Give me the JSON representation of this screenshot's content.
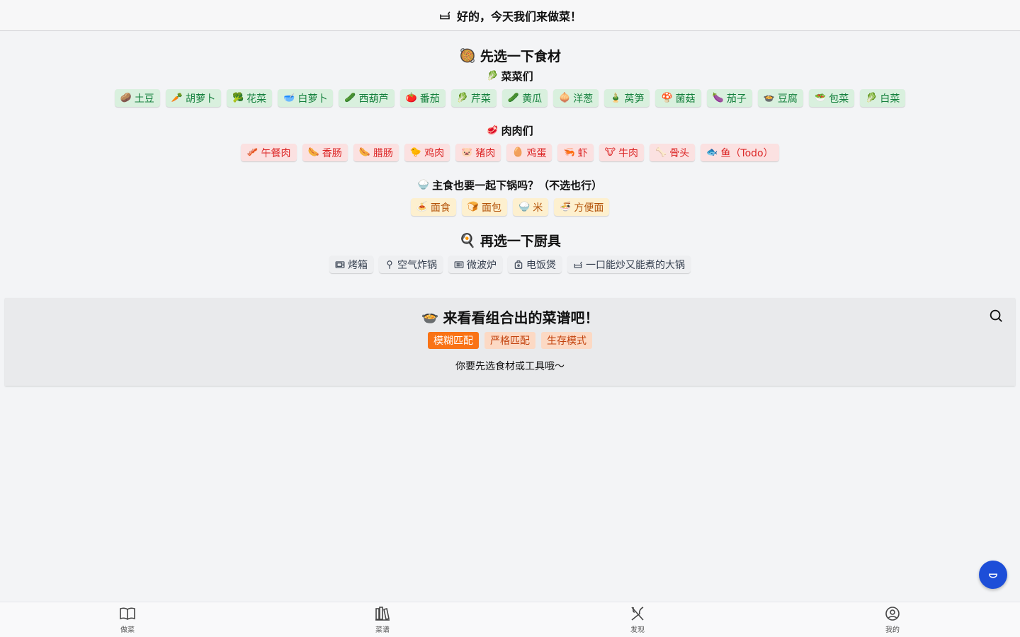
{
  "header": {
    "title": "好的，今天我们来做菜！",
    "icon": "pot-icon"
  },
  "ingredients": {
    "title": "先选一下食材",
    "icon": "🥘",
    "veg": {
      "title": "菜菜们",
      "icon": "🥬",
      "items": [
        {
          "icon": "🥔",
          "label": "土豆"
        },
        {
          "icon": "🥕",
          "label": "胡萝卜"
        },
        {
          "icon": "🥦",
          "label": "花菜"
        },
        {
          "icon": "🥣",
          "label": "白萝卜"
        },
        {
          "icon": "🥒",
          "label": "西葫芦"
        },
        {
          "icon": "🍅",
          "label": "番茄"
        },
        {
          "icon": "🥬",
          "label": "芹菜"
        },
        {
          "icon": "🥒",
          "label": "黄瓜"
        },
        {
          "icon": "🧅",
          "label": "洋葱"
        },
        {
          "icon": "🎍",
          "label": "莴笋"
        },
        {
          "icon": "🍄",
          "label": "菌菇"
        },
        {
          "icon": "🍆",
          "label": "茄子"
        },
        {
          "icon": "🍲",
          "label": "豆腐"
        },
        {
          "icon": "🥗",
          "label": "包菜"
        },
        {
          "icon": "🥬",
          "label": "白菜"
        }
      ]
    },
    "meat": {
      "title": "肉肉们",
      "icon": "🥩",
      "items": [
        {
          "icon": "🥓",
          "label": "午餐肉"
        },
        {
          "icon": "🌭",
          "label": "香肠"
        },
        {
          "icon": "🌭",
          "label": "腊肠"
        },
        {
          "icon": "🐤",
          "label": "鸡肉"
        },
        {
          "icon": "🐷",
          "label": "猪肉"
        },
        {
          "icon": "🥚",
          "label": "鸡蛋"
        },
        {
          "icon": "🦐",
          "label": "虾"
        },
        {
          "icon": "🐮",
          "label": "牛肉"
        },
        {
          "icon": "🦴",
          "label": "骨头"
        },
        {
          "icon": "🐟",
          "label": "鱼（Todo）"
        }
      ]
    },
    "staple": {
      "title": "主食也要一起下锅吗？（不选也行）",
      "icon": "🍚",
      "items": [
        {
          "icon": "🍝",
          "label": "面食"
        },
        {
          "icon": "🍞",
          "label": "面包"
        },
        {
          "icon": "🍚",
          "label": "米"
        },
        {
          "icon": "🍜",
          "label": "方便面"
        }
      ]
    }
  },
  "tools": {
    "title": "再选一下厨具",
    "icon": "🍳",
    "items": [
      {
        "icon": "oven-icon",
        "label": "烤箱"
      },
      {
        "icon": "air-fryer-icon",
        "label": "空气炸锅"
      },
      {
        "icon": "microwave-icon",
        "label": "微波炉"
      },
      {
        "icon": "rice-cooker-icon",
        "label": "电饭煲"
      },
      {
        "icon": "wok-icon",
        "label": "一口能炒又能煮的大锅"
      }
    ]
  },
  "results": {
    "title": "来看看组合出的菜谱吧！",
    "icon": "🍲",
    "modes": [
      "模糊匹配",
      "严格匹配",
      "生存模式"
    ],
    "active_mode": "模糊匹配",
    "hint": "你要先选食材或工具哦～"
  },
  "nav": [
    {
      "label": "做菜",
      "icon": "book-icon"
    },
    {
      "label": "菜谱",
      "icon": "library-icon"
    },
    {
      "label": "发现",
      "icon": "utensils-icon"
    },
    {
      "label": "我的",
      "icon": "user-circle-icon"
    }
  ],
  "colors": {
    "veg": "#15803d",
    "meat": "#dc2626",
    "staple": "#b45309",
    "accent": "#f97316",
    "fab": "#1d4ed8"
  }
}
